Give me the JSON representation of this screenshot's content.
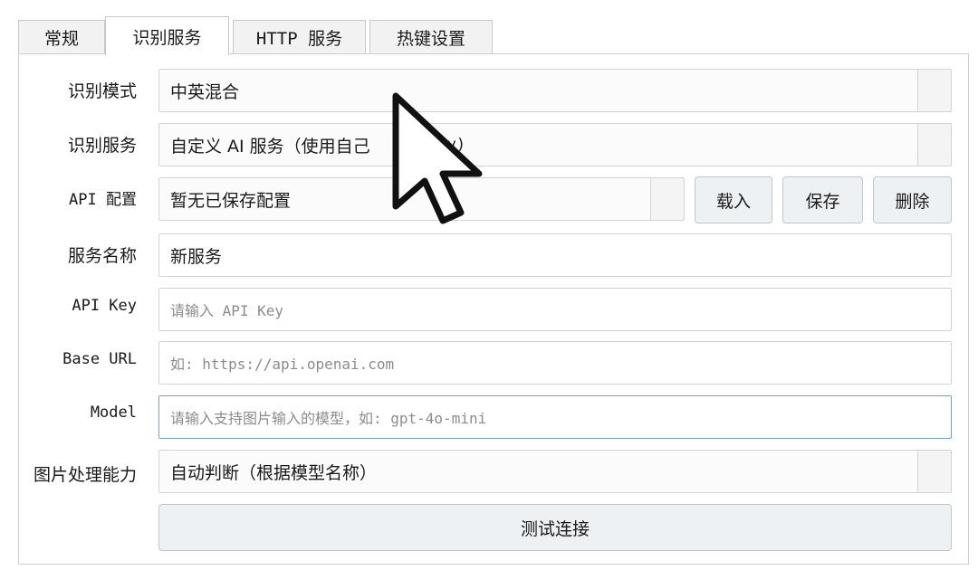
{
  "tabs": [
    {
      "label": "常规"
    },
    {
      "label": "识别服务"
    },
    {
      "label": "HTTP 服务"
    },
    {
      "label": "热键设置"
    }
  ],
  "form": {
    "recognition_mode": {
      "label": "识别模式",
      "value": "中英混合"
    },
    "recognition_service": {
      "label": "识别服务",
      "value_prefix": "自定义 AI 服务（使用自己",
      "value_suffix": "I Key)"
    },
    "api_config": {
      "label": "API 配置",
      "value": "暂无已保存配置",
      "load_button": "载入",
      "save_button": "保存",
      "delete_button": "删除"
    },
    "service_name": {
      "label": "服务名称",
      "value": "新服务"
    },
    "api_key": {
      "label": "API Key",
      "placeholder": "请输入 API Key"
    },
    "base_url": {
      "label": "Base URL",
      "placeholder": "如: https://api.openai.com"
    },
    "model": {
      "label": "Model",
      "placeholder": "请输入支持图片输入的模型，如: gpt-4o-mini"
    },
    "image_capability": {
      "label": "图片处理能力",
      "value": "自动判断（根据模型名称）"
    },
    "test_button": "测试连接"
  },
  "icons": {
    "cursor": "mouse-pointer-icon",
    "dropdown": "dropdown-arrow"
  }
}
